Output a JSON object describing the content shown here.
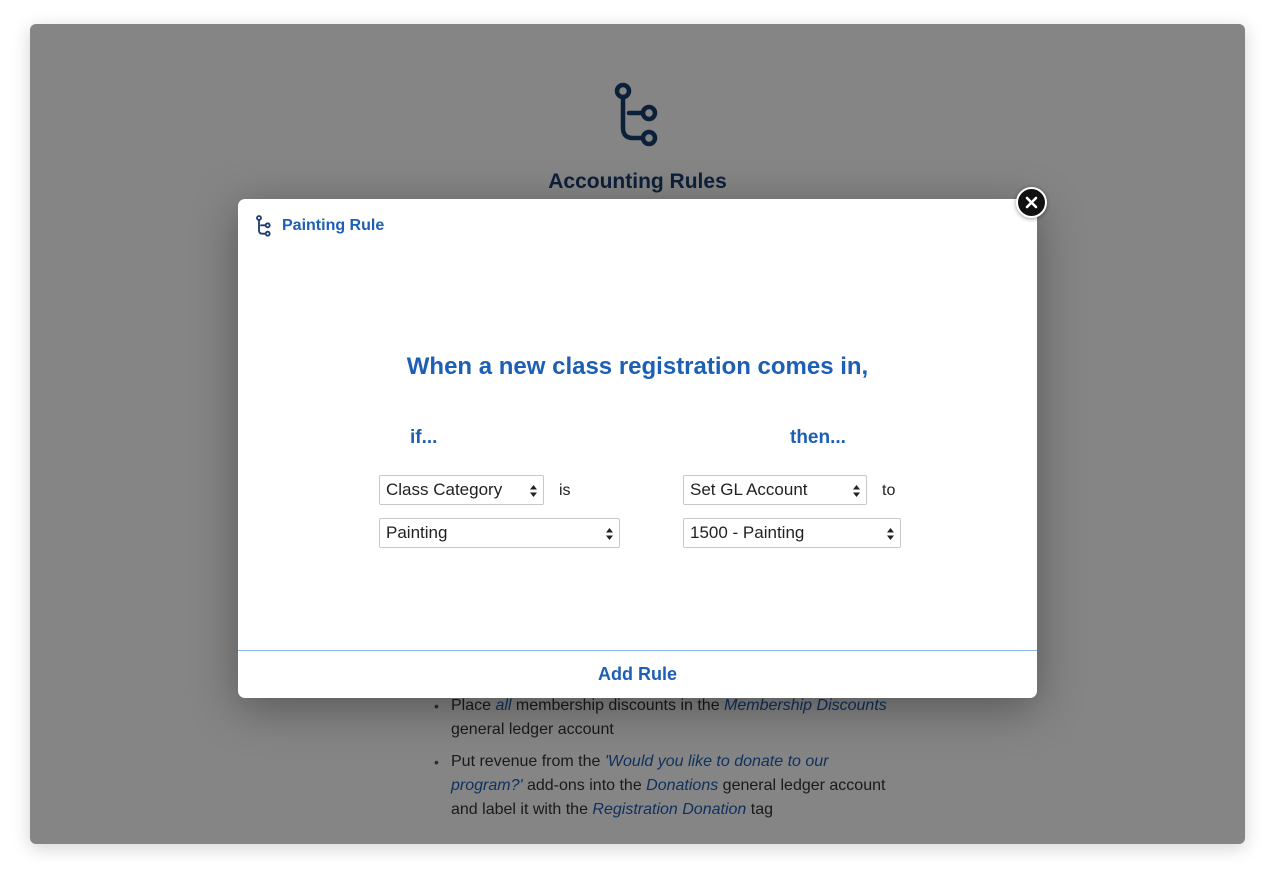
{
  "background": {
    "page_title": "Accounting Rules",
    "examples": [
      {
        "parts": [
          {
            "text": "Place ",
            "em": false
          },
          {
            "text": "all",
            "em": true
          },
          {
            "text": " membership discounts in the ",
            "em": false
          },
          {
            "text": "Membership Discounts",
            "em": true
          },
          {
            "text": " general ledger account",
            "em": false
          }
        ]
      },
      {
        "parts": [
          {
            "text": "Put revenue from the ",
            "em": false
          },
          {
            "text": "'Would you like to donate to our program?'",
            "em": true
          },
          {
            "text": " add-ons into the ",
            "em": false
          },
          {
            "text": "Donations",
            "em": true
          },
          {
            "text": " general ledger account and label it with the ",
            "em": false
          },
          {
            "text": "Registration Donation",
            "em": true
          },
          {
            "text": " tag",
            "em": false
          }
        ]
      }
    ]
  },
  "modal": {
    "title": "Painting Rule",
    "headline": "When a new class registration comes in,",
    "if_label": "if...",
    "then_label": "then...",
    "condition": {
      "field_select": "Class Category",
      "operator": "is",
      "value_select": "Painting"
    },
    "action": {
      "action_select": "Set GL Account",
      "connector": "to",
      "value_select": "1500 - Painting"
    },
    "add_rule_label": "Add Rule"
  },
  "icons": {
    "logo": "accounting-rules-logo-icon",
    "close": "close-icon",
    "select_arrows": "select-arrows-icon"
  },
  "colors": {
    "accent": "#1c5fb5",
    "dark_title": "#1a3e6e",
    "overlay": "rgba(0,0,0,0.48)",
    "divider": "#8fb8e3"
  }
}
